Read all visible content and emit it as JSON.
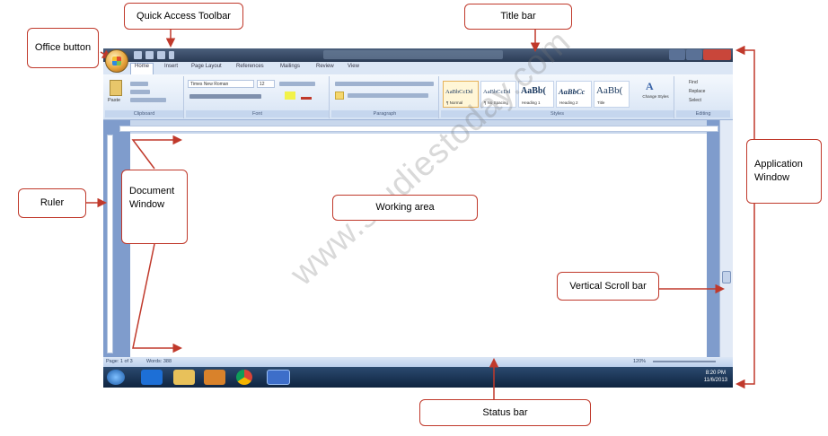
{
  "labels": {
    "quick_access_toolbar": "Quick Access Toolbar",
    "title_bar": "Title bar",
    "office_button": "Office button",
    "ruler": "Ruler",
    "document_window": "Document Window",
    "working_area": "Working area",
    "application_window": "Application Window",
    "vertical_scroll_bar": "Vertical Scroll bar",
    "status_bar": "Status bar"
  },
  "watermark": "www.studiestoday.com",
  "arrow_color": "#c0392b",
  "word": {
    "tabs": [
      "Home",
      "Insert",
      "Page Layout",
      "References",
      "Mailings",
      "Review",
      "View"
    ],
    "groups": [
      "Clipboard",
      "Font",
      "Paragraph",
      "Styles",
      "Editing"
    ],
    "paste_label": "Paste",
    "font_name": "Times New Roman",
    "font_size": "12",
    "styles": [
      {
        "sample": "AaBbCcDd",
        "name": "¶ Normal"
      },
      {
        "sample": "AaBbCcDd",
        "name": "¶ No Spacing"
      },
      {
        "sample": "AaBb(",
        "name": "Heading 1"
      },
      {
        "sample": "AaBbCc",
        "name": "Heading 2"
      },
      {
        "sample": "AaBb(",
        "name": "Title"
      }
    ],
    "change_styles": "Change Styles",
    "editing": [
      "Find",
      "Replace",
      "Select"
    ],
    "status": {
      "page": "Page: 1 of 3",
      "words": "Words: 388",
      "zoom": "120%"
    },
    "clock": {
      "time": "8:20 PM",
      "date": "11/6/2013"
    }
  }
}
